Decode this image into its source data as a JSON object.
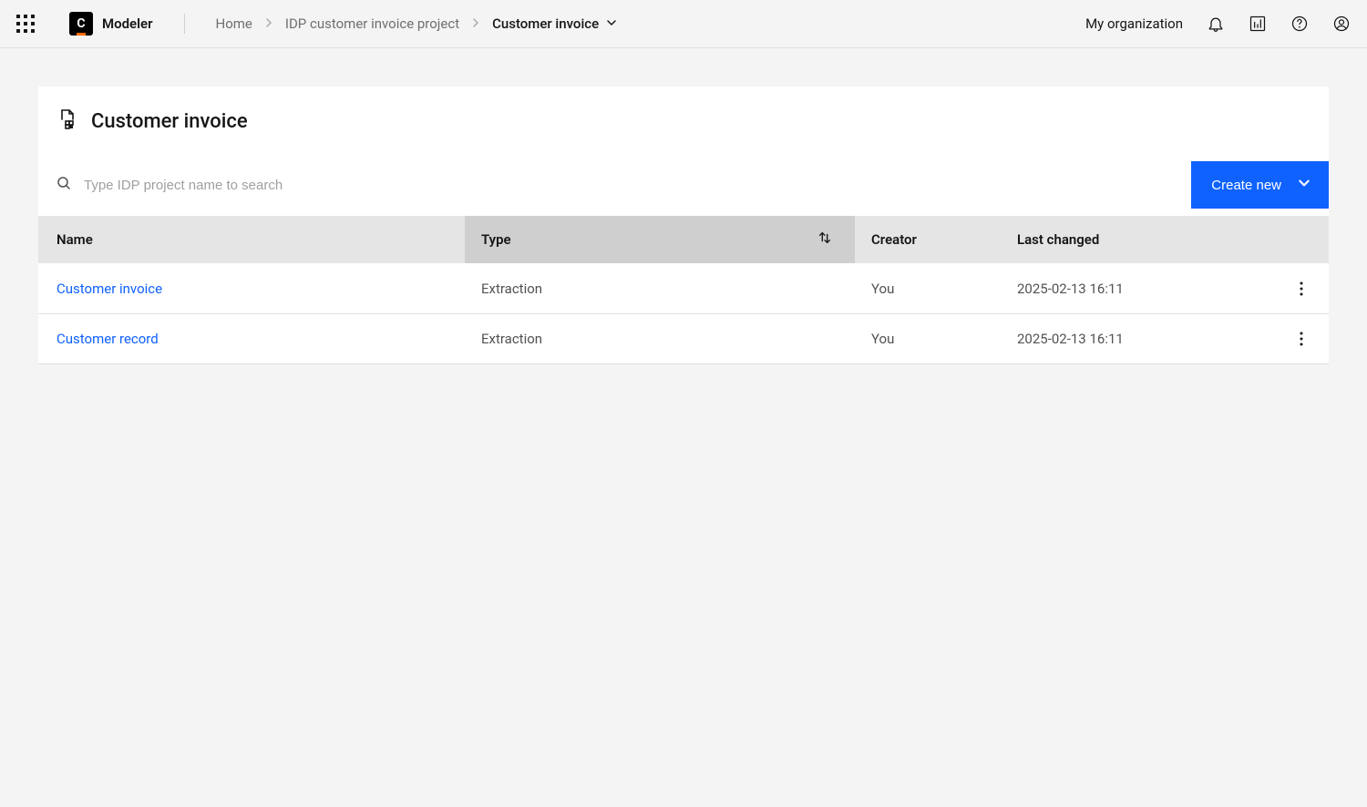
{
  "header": {
    "app_name": "Modeler",
    "breadcrumbs": {
      "home": "Home",
      "project": "IDP customer invoice project",
      "current": "Customer invoice"
    },
    "org_link": "My organization"
  },
  "page": {
    "title": "Customer invoice",
    "search_placeholder": "Type IDP project name to search",
    "create_button": "Create new"
  },
  "table": {
    "columns": {
      "name": "Name",
      "type": "Type",
      "creator": "Creator",
      "last_changed": "Last changed"
    },
    "rows": [
      {
        "name": "Customer invoice",
        "type": "Extraction",
        "creator": "You",
        "last_changed": "2025-02-13 16:11"
      },
      {
        "name": "Customer record",
        "type": "Extraction",
        "creator": "You",
        "last_changed": "2025-02-13 16:11"
      }
    ]
  }
}
